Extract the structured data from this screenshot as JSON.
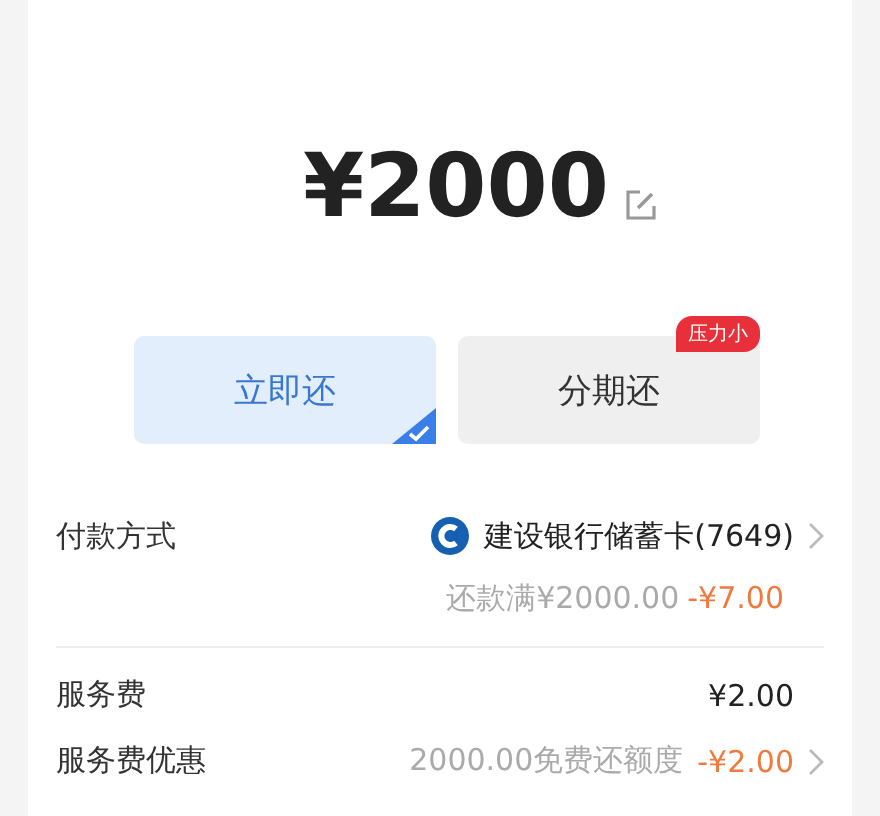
{
  "amount": {
    "text": "¥2000"
  },
  "options": [
    {
      "label": "立即还",
      "selected": true
    },
    {
      "label": "分期还",
      "selected": false,
      "badge": "压力小"
    }
  ],
  "payment": {
    "label": "付款方式",
    "card": "建设银行储蓄卡(7649)",
    "discount_note": "还款满¥2000.00",
    "discount": "-¥7.00"
  },
  "fees": [
    {
      "label": "服务费",
      "kind": "plain",
      "value": "¥2.00"
    },
    {
      "label": "服务费优惠",
      "kind": "discount",
      "note": "2000.00免费还额度",
      "value": "-¥2.00"
    }
  ]
}
